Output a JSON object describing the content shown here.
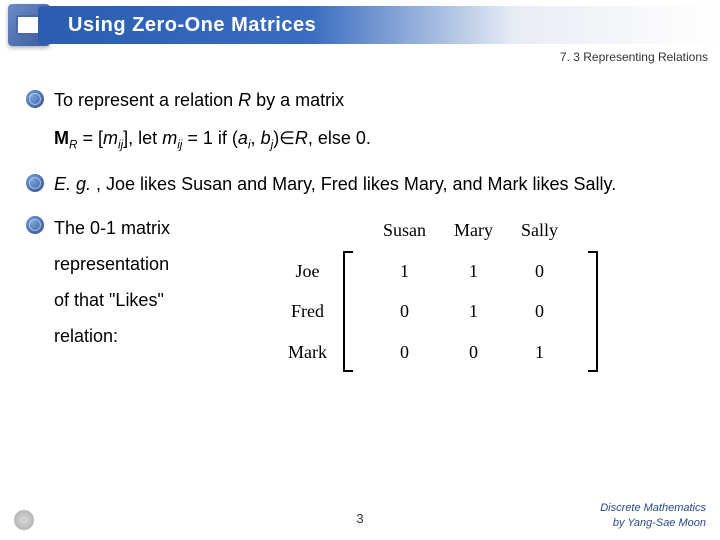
{
  "header": {
    "title": "Using Zero-One Matrices",
    "section": "7. 3 Representing Relations"
  },
  "bullets": {
    "b1_pre": "To represent a relation ",
    "b1_R": "R",
    "b1_post": " by a matrix",
    "def_pre": "M",
    "def_R": "R",
    "def_eq": " = [",
    "def_m": "m",
    "def_ij1": "ij",
    "def_mid": "], let ",
    "def_m2": "m",
    "def_ij2": "ij",
    "def_eq1": " = 1 if (",
    "def_a": "a",
    "def_i": "i",
    "def_comma": ", ",
    "def_b": "b",
    "def_j": "j",
    "def_in": ")∈",
    "def_R2": "R",
    "def_end": ", else 0.",
    "b2_pre": "E. g.",
    "b2_post": " , Joe likes Susan and Mary, Fred likes Mary, and Mark likes Sally.",
    "b3": "The 0-1 matrix",
    "b3_l2": "representation",
    "b3_l3": "of that \"Likes\"",
    "b3_l4": "relation:"
  },
  "chart_data": {
    "type": "table",
    "title": "Likes relation 0-1 matrix",
    "columns": [
      "Susan",
      "Mary",
      "Sally"
    ],
    "rows": [
      "Joe",
      "Fred",
      "Mark"
    ],
    "values": [
      [
        1,
        1,
        0
      ],
      [
        0,
        1,
        0
      ],
      [
        0,
        0,
        1
      ]
    ]
  },
  "footer": {
    "page": "3",
    "credit1": "Discrete Mathematics",
    "credit2": "by Yang-Sae Moon"
  }
}
